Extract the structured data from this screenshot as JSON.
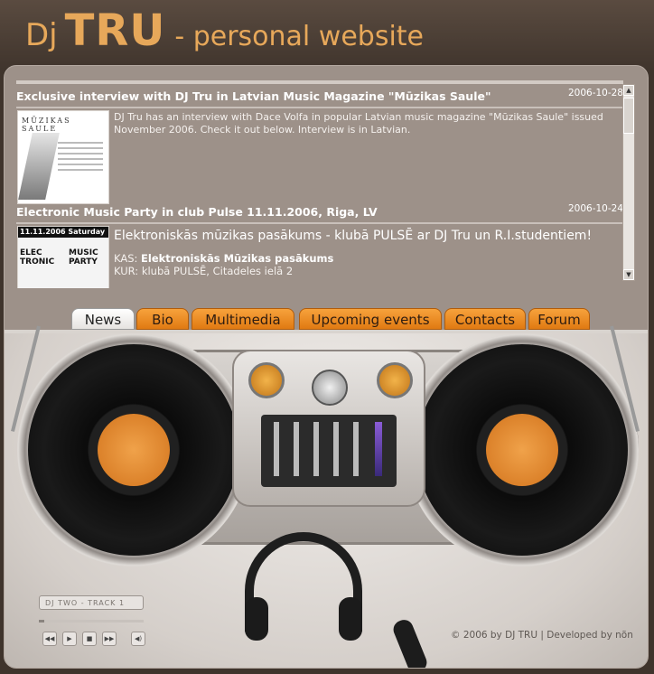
{
  "header": {
    "title_prefix": "Dj",
    "title_brand": "TRU",
    "title_suffix": "- personal website"
  },
  "news": [
    {
      "title": "Exclusive interview with DJ Tru in Latvian Music Magazine \"Mūzikas Saule\"",
      "date": "2006-10-28",
      "thumb_caption": "MŪZIKAS SAULE",
      "text": "DJ Tru has an interview with Dace Volfa in popular Latvian music magazine \"Mūzikas Saule\" issued November 2006. Check it out below. Interview is in Latvian."
    },
    {
      "title": "Electronic Music Party in club Pulse 11.11.2006, Riga, LV",
      "date": "2006-10-24",
      "thumb_top": "11.11.2006 Saturday",
      "thumb_left": "ELEC TRONIC",
      "thumb_right": "MUSIC PARTY",
      "headline": "Elektroniskās mūzikas pasākums - klubā PULSĒ ar DJ Tru un R.I.studentiem!",
      "kas_label": "KAS:",
      "kas_value": "Elektroniskās Mūzikas pasākums",
      "kur_label": "KUR:",
      "kur_value": "klubā PULSĒ, Citadeles ielā 2"
    }
  ],
  "nav": [
    "News",
    "Bio",
    "Multimedia",
    "Upcoming events",
    "Contacts",
    "Forum"
  ],
  "player": {
    "track": "DJ TWO - TRACK 1",
    "progress": 0.05,
    "controls": [
      "rewind",
      "play",
      "stop",
      "fast-forward",
      "volume"
    ]
  },
  "footer": "© 2006 by DJ TRU | Developed by nõn",
  "colors": {
    "accent": "#e7a85a",
    "tab_orange": "#f29a30",
    "panel": "#9d9189"
  }
}
